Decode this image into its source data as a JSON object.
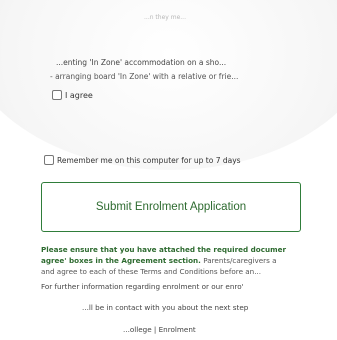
{
  "top_faded_text": "...n they me...",
  "terms": {
    "item_a": "...enting 'In Zone' accommodation on a sho...",
    "item_b": "- arranging board 'In Zone' with a relative or frie...",
    "agree_label": "I agree"
  },
  "remember": {
    "label": "Remember me on this computer for up to 7 days"
  },
  "submit": {
    "label": "Submit Enrolment Application"
  },
  "notice": {
    "line1_bold": "Please ensure that you have attached the required documer",
    "line2_bold": "agree' boxes in the Agreement section.",
    "line2_rest": " Parents/caregivers a",
    "line3": "and agree to each of these Terms and Conditions before an..."
  },
  "further_info": "For further information regarding enrolment or our enro'",
  "contact_text": "...ll be in contact with you about the next step",
  "footer_text": "...ollege | Enrolment",
  "colors": {
    "accent": "#2e6b30",
    "border": "#2f7d3a"
  }
}
